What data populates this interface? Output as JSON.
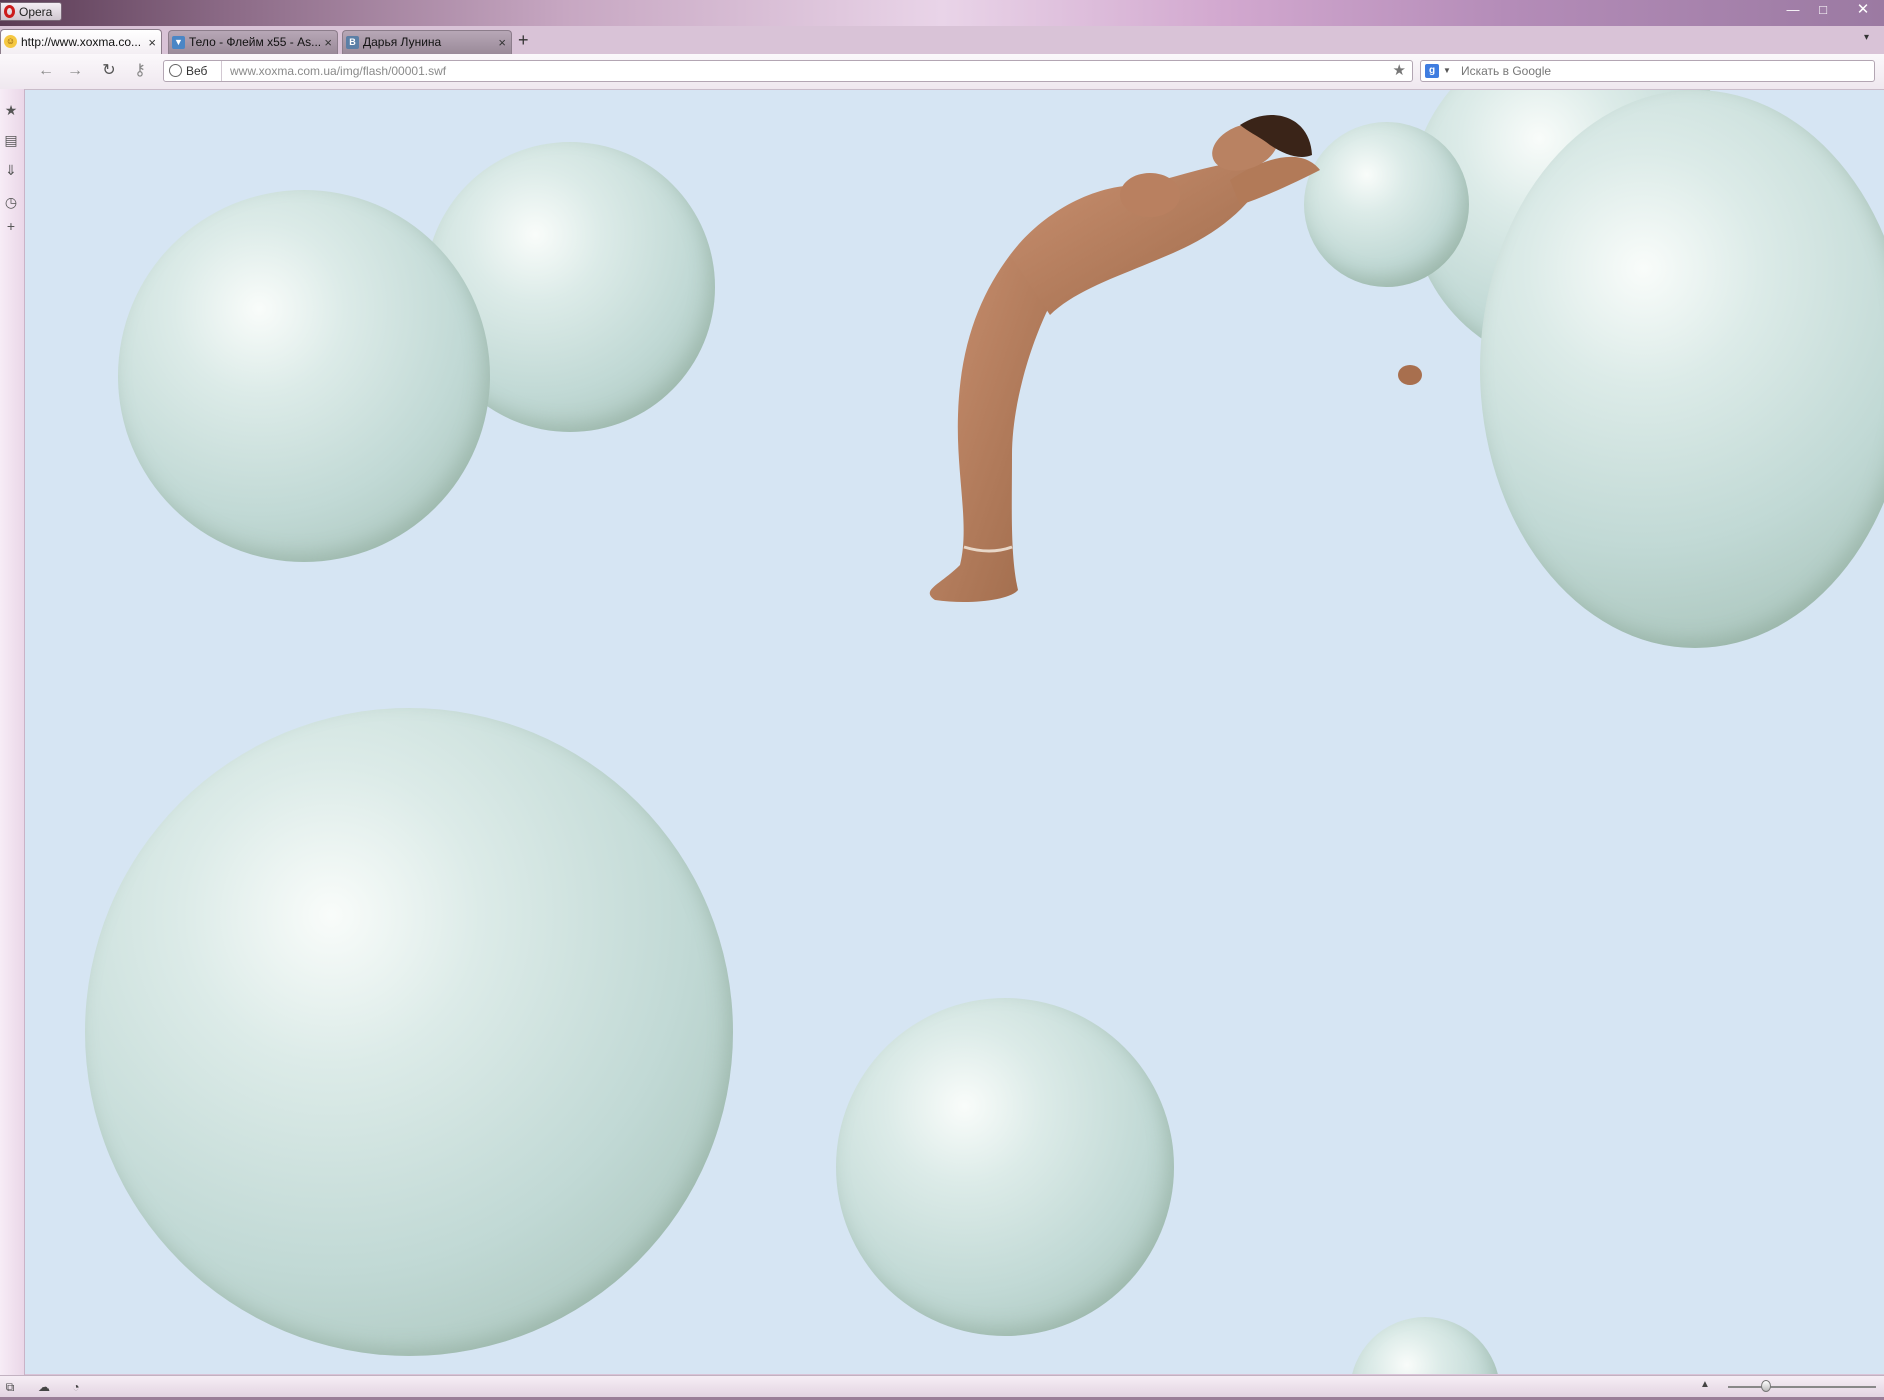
{
  "window": {
    "menu_label": "Opera",
    "controls": {
      "minimize": "—",
      "maximize": "□",
      "close": "✕"
    }
  },
  "tabs": [
    {
      "title": "http://www.xoxma.co...",
      "icon": "smiley-favicon",
      "active": true
    },
    {
      "title": "Тело - Флейм х55 - As...",
      "icon": "forum-favicon",
      "active": false
    },
    {
      "title": "Дарья Лунина",
      "icon": "vk-favicon",
      "favicon_letter": "В",
      "active": false
    }
  ],
  "tab_close_glyph": "×",
  "new_tab_glyph": "+",
  "tab_menu_glyph": "▾",
  "nav": {
    "back_glyph": "←",
    "forward_glyph": "→",
    "reload_glyph": "↻",
    "key_glyph": "⚷",
    "site_info_label": "Веб",
    "url": "www.xoxma.com.ua/img/flash/00001.swf",
    "bookmark_glyph": "★"
  },
  "search": {
    "engine_letter": "g",
    "dropdown_glyph": "▼",
    "placeholder": "Искать в Google"
  },
  "sidebar": {
    "items": [
      {
        "icon": "bookmarks-star-icon",
        "glyph": "★"
      },
      {
        "icon": "notes-icon",
        "glyph": "▤"
      },
      {
        "icon": "downloads-icon",
        "glyph": "⇓"
      },
      {
        "icon": "history-clock-icon",
        "glyph": "◷"
      },
      {
        "icon": "add-panel-icon",
        "glyph": "+"
      }
    ]
  },
  "status": {
    "panel_toggle_glyph": "⧉",
    "unite_glyph": "☁",
    "turbo_glyph": "◔",
    "zoom_up_glyph": "▲",
    "zoom_fraction": 0.24
  },
  "colors": {
    "content_background": "#d6e5f3",
    "bubble_color": "#c1d9d5",
    "skin_color": "#b8805c",
    "hair_color": "#3a2418"
  }
}
